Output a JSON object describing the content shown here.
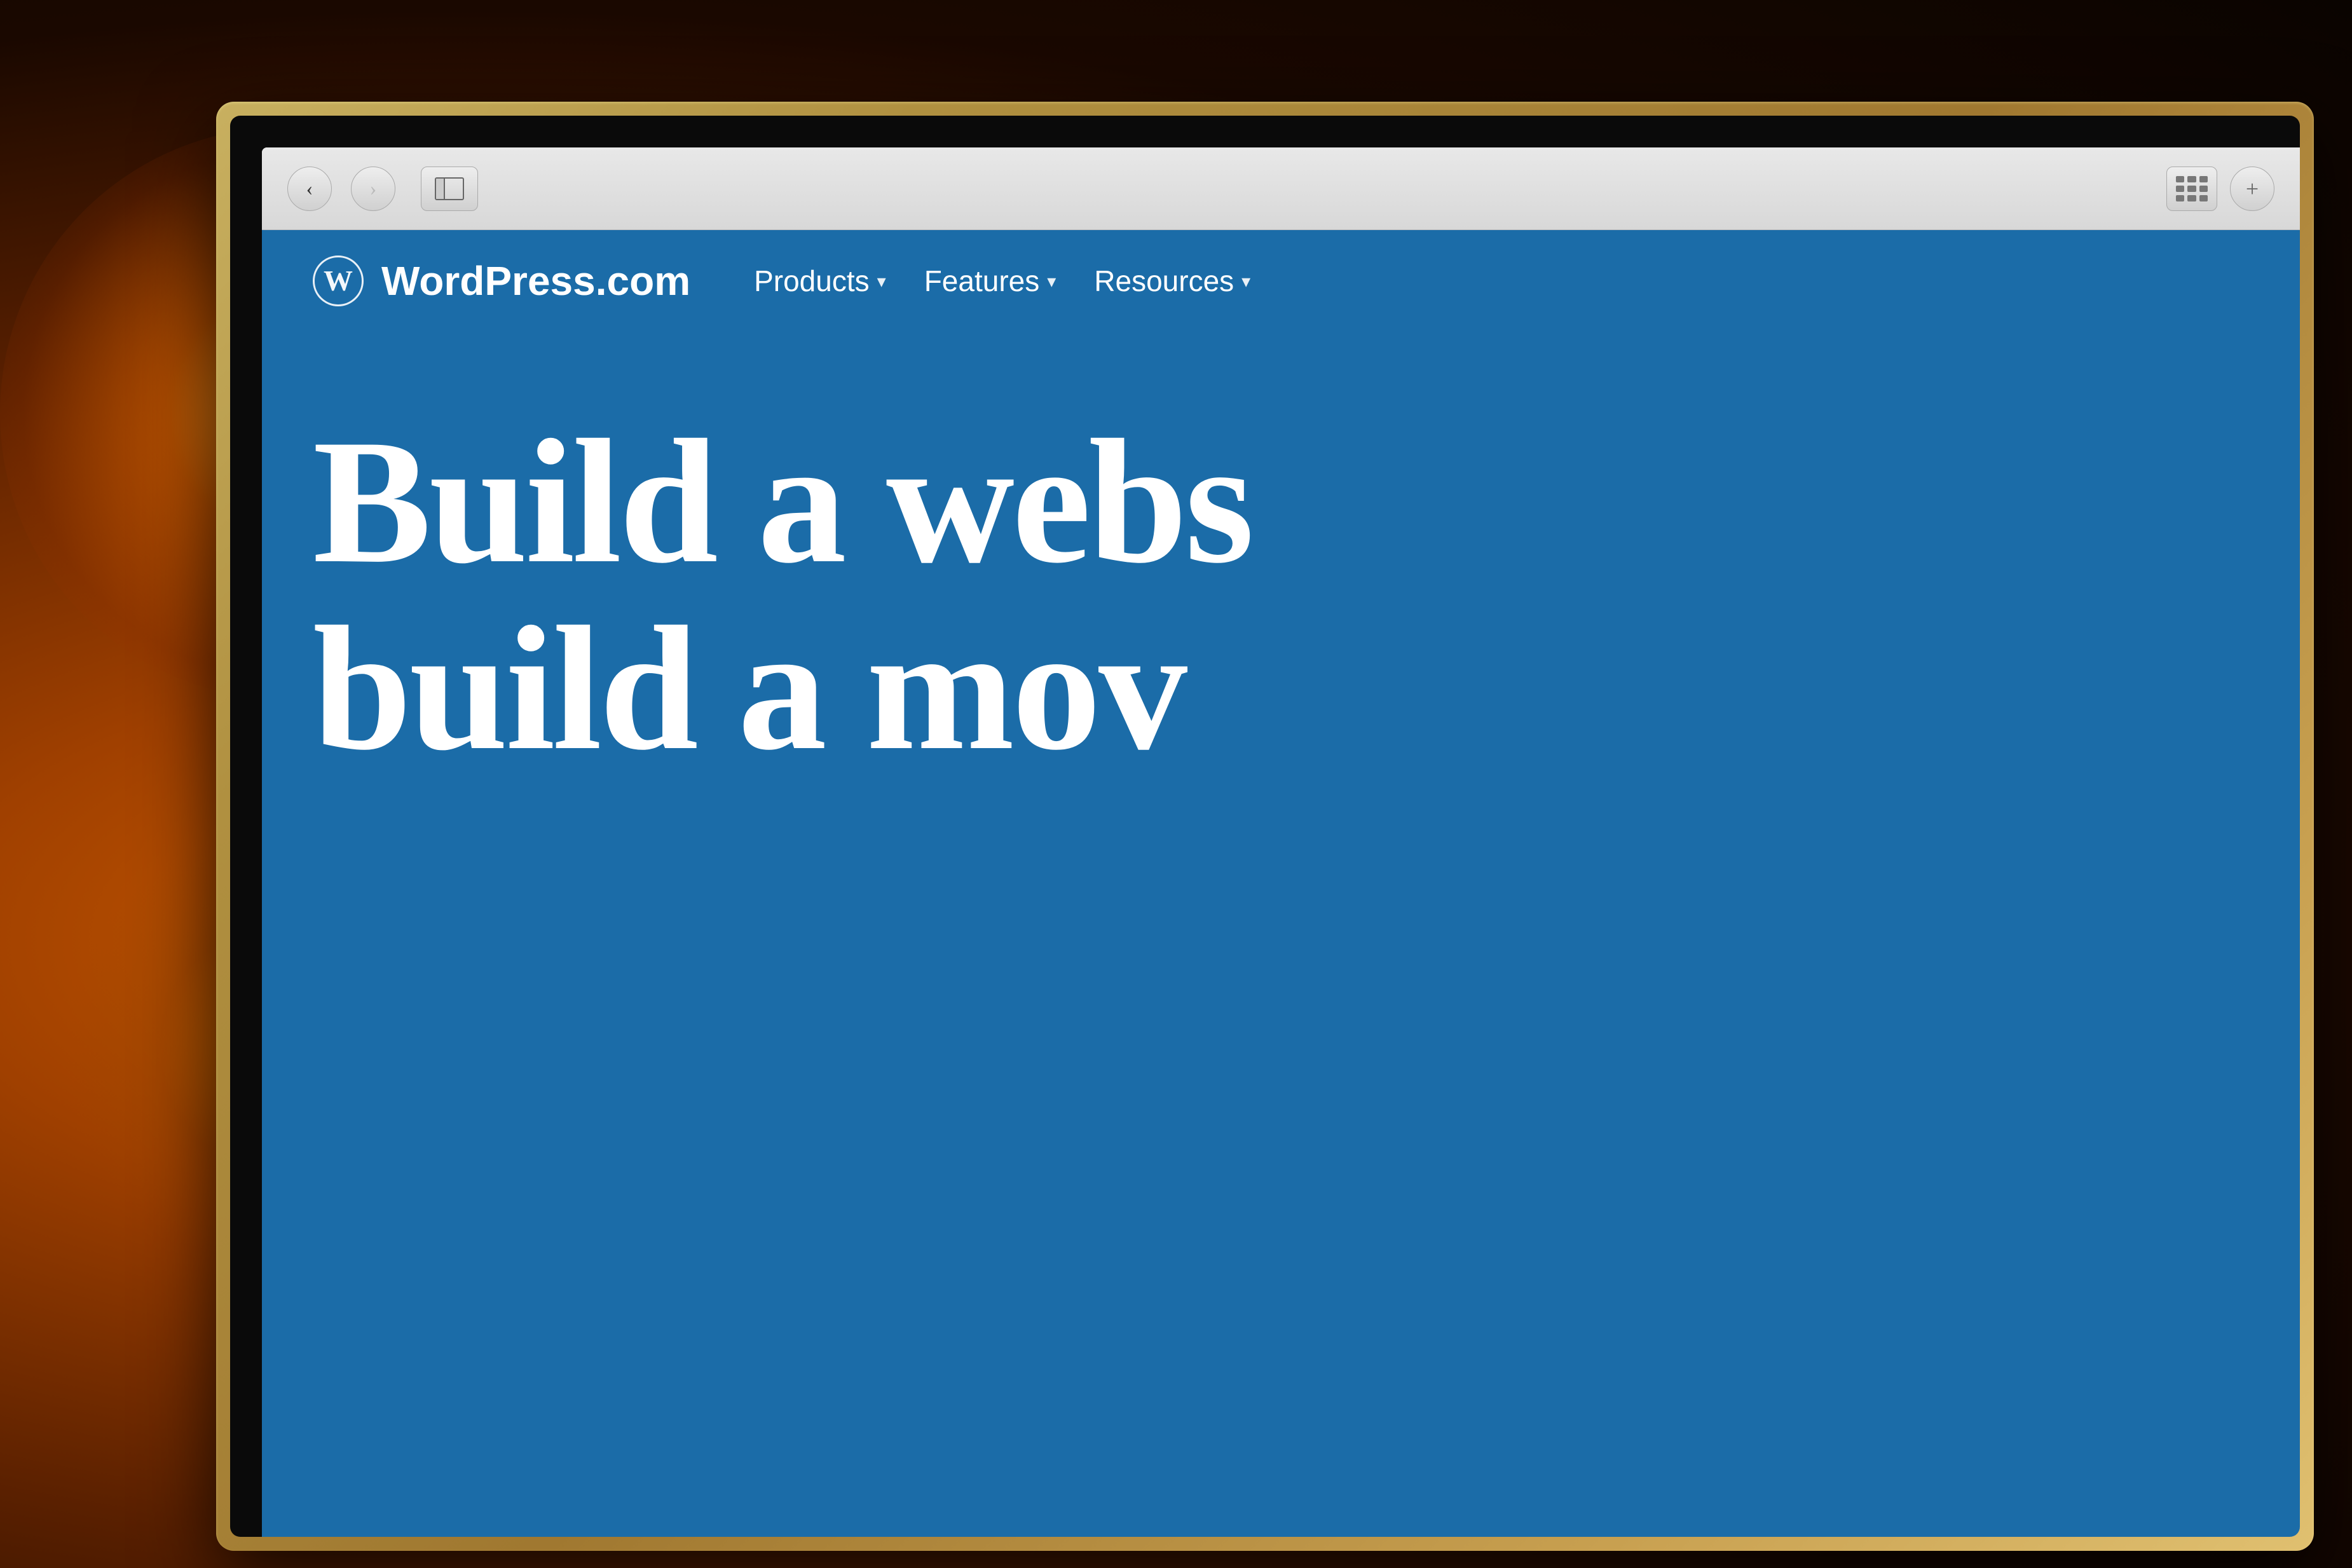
{
  "background": {
    "color": "#1a0a00"
  },
  "browser": {
    "back_button_label": "‹",
    "forward_button_label": "›",
    "grid_button_label": "⋯",
    "plus_button_label": "+"
  },
  "website": {
    "logo_letter": "W",
    "site_name": "WordPress.com",
    "nav": {
      "items": [
        {
          "label": "Products",
          "has_dropdown": true
        },
        {
          "label": "Features",
          "has_dropdown": true
        },
        {
          "label": "Resources",
          "has_dropdown": true
        }
      ]
    },
    "hero": {
      "line1": "Build a webs",
      "line2": "build a mov"
    },
    "bg_color": "#1b6ca8"
  }
}
